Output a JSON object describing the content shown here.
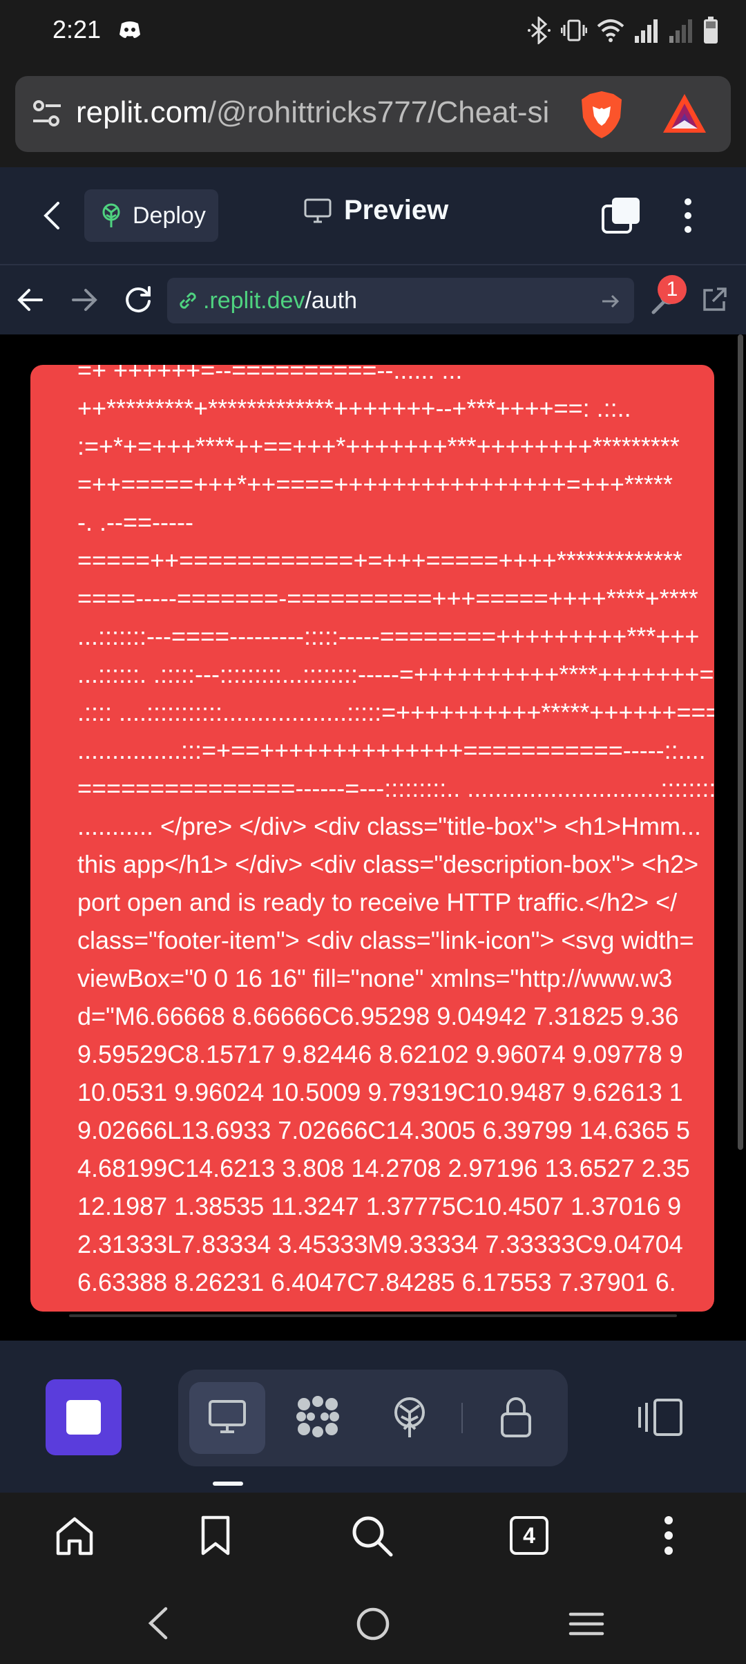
{
  "status_bar": {
    "time": "2:21"
  },
  "browser": {
    "url_host": "replit.com",
    "url_path": "/@rohittricks777/Cheat-si",
    "tab_count": "4"
  },
  "replit_header": {
    "deploy_label": "Deploy",
    "preview_label": "Preview"
  },
  "webview": {
    "url_host": ".replit.dev",
    "url_path": "/auth",
    "devtools_badge": "1"
  },
  "content": {
    "card_color": "#ef4444",
    "lines": [
      "=+                              ++++++=--==========--...... ...",
      "++*********+*************+++++++--+***++++==: .::..",
      ":=+*+=+++****++==+++*+++++++***++++++++*********",
      "=++=====+++*++====++++++++++++++++=+++*****",
      "-. .--==-----",
      "=====++============+=+++=====++++*************",
      "====-----=======-==========+++=====++++****+****",
      "...:::::::---====---------:::::-----========+++++++++***+++",
      "...::::::.  .:::::---:::::::::...::::::::-----=++++++++++****+++++++=",
      " .::::  ....:::::::::::..................:::::=++++++++++*****++++++===",
      "...............:::=+==++++++++++++++===========-----::....",
      "===============------=---:::::::::..  ............................::::::::-----",
      "........... </pre> </div> <div class=\"title-box\"> <h1>Hmm...",
      "this app</h1> </div> <div class=\"description-box\"> <h2>",
      "port open and is ready to receive HTTP traffic.</h2> </",
      "class=\"footer-item\"> <div class=\"link-icon\"> <svg width=",
      "viewBox=\"0 0 16 16\" fill=\"none\" xmlns=\"http://www.w3",
      "d=\"M6.66668 8.66666C6.95298 9.04942 7.31825 9.36",
      "9.59529C8.15717 9.82446 8.62102 9.96074 9.09778 9",
      "10.0531 9.96024 10.5009 9.79319C10.9487 9.62613 1",
      "9.02666L13.6933 7.02666C14.3005 6.39799 14.6365 5",
      "4.68199C14.6213 3.808 14.2708 2.97196 13.6527 2.35",
      "12.1987 1.38535 11.3247 1.37775C10.4507 1.37016 9",
      "2.31333L7.83334 3.45333M9.33334 7.33333C9.04704",
      "6.63388 8.26231 6.4047C7.84285 6.17553 7.37901 6."
    ]
  },
  "colors": {
    "replit_bg": "#1c2333",
    "replit_surface": "#2b3245",
    "stop_button": "#5a3ddc",
    "link_green": "#4fd380",
    "badge_red": "#f04a49"
  }
}
